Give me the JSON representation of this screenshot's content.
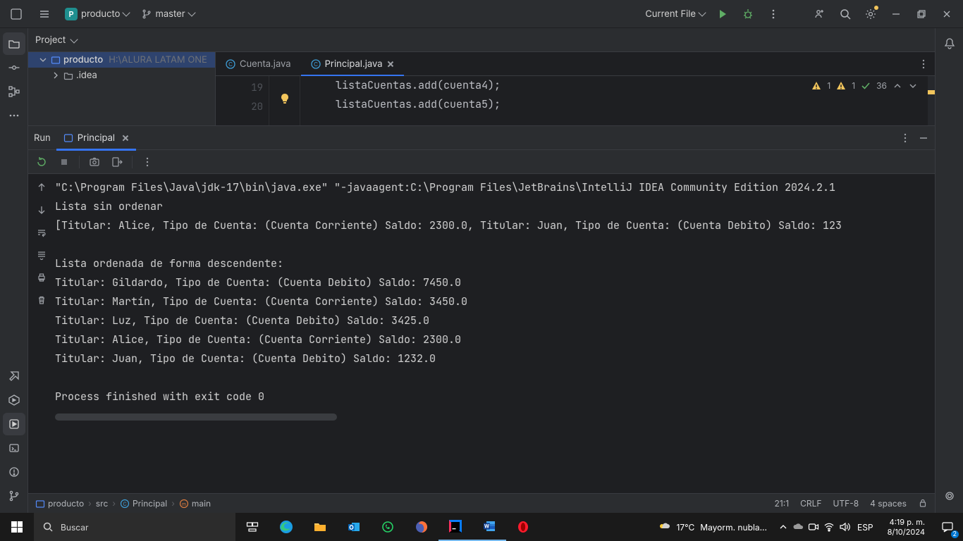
{
  "titlebar": {
    "project_name": "producto",
    "project_badge": "P",
    "branch_name": "master",
    "run_config": "Current File"
  },
  "project_panel": {
    "title": "Project",
    "tree": {
      "root": {
        "name": "producto",
        "path_hint": "H:\\ALURA LATAM ONE"
      },
      "child1": {
        "name": ".idea"
      }
    }
  },
  "editor": {
    "tabs": [
      {
        "label": "Cuenta.java"
      },
      {
        "label": "Principal.java",
        "active": true
      }
    ],
    "gutter_lines": [
      "19",
      "20"
    ],
    "code_lines": [
      "listaCuentas.add(cuenta4);",
      "listaCuentas.add(cuenta5);"
    ],
    "inspection": {
      "warn1": "1",
      "warn2": "1",
      "ok_count": "36"
    }
  },
  "run_panel": {
    "title": "Run",
    "tab_label": "Principal",
    "console_lines": [
      "\"C:\\Program Files\\Java\\jdk-17\\bin\\java.exe\" \"-javaagent:C:\\Program Files\\JetBrains\\IntelliJ IDEA Community Edition 2024.2.1",
      "Lista sin ordenar",
      "[Titular: Alice, Tipo de Cuenta: (Cuenta Corriente) Saldo: 2300.0, Titular: Juan, Tipo de Cuenta: (Cuenta Debito) Saldo: 123",
      "",
      "Lista ordenada de forma descendente:",
      "Titular: Gildardo, Tipo de Cuenta: (Cuenta Debito) Saldo: 7450.0",
      "Titular: Martín, Tipo de Cuenta: (Cuenta Corriente) Saldo: 3450.0",
      "Titular: Luz, Tipo de Cuenta: (Cuenta Debito) Saldo: 3425.0",
      "Titular: Alice, Tipo de Cuenta: (Cuenta Corriente) Saldo: 2300.0",
      "Titular: Juan, Tipo de Cuenta: (Cuenta Debito) Saldo: 1232.0",
      "",
      "Process finished with exit code 0"
    ]
  },
  "breadcrumb": {
    "items": [
      "producto",
      "src",
      "Principal",
      "main"
    ]
  },
  "statusbar": {
    "caret": "21:1",
    "line_sep": "CRLF",
    "encoding": "UTF-8",
    "indent": "4 spaces"
  },
  "taskbar": {
    "search_placeholder": "Buscar",
    "weather_temp": "17°C",
    "weather_text": "Mayorm. nubla...",
    "lang": "ESP",
    "time": "4:19 p. m.",
    "date": "8/10/2024",
    "notif_count": "2"
  }
}
